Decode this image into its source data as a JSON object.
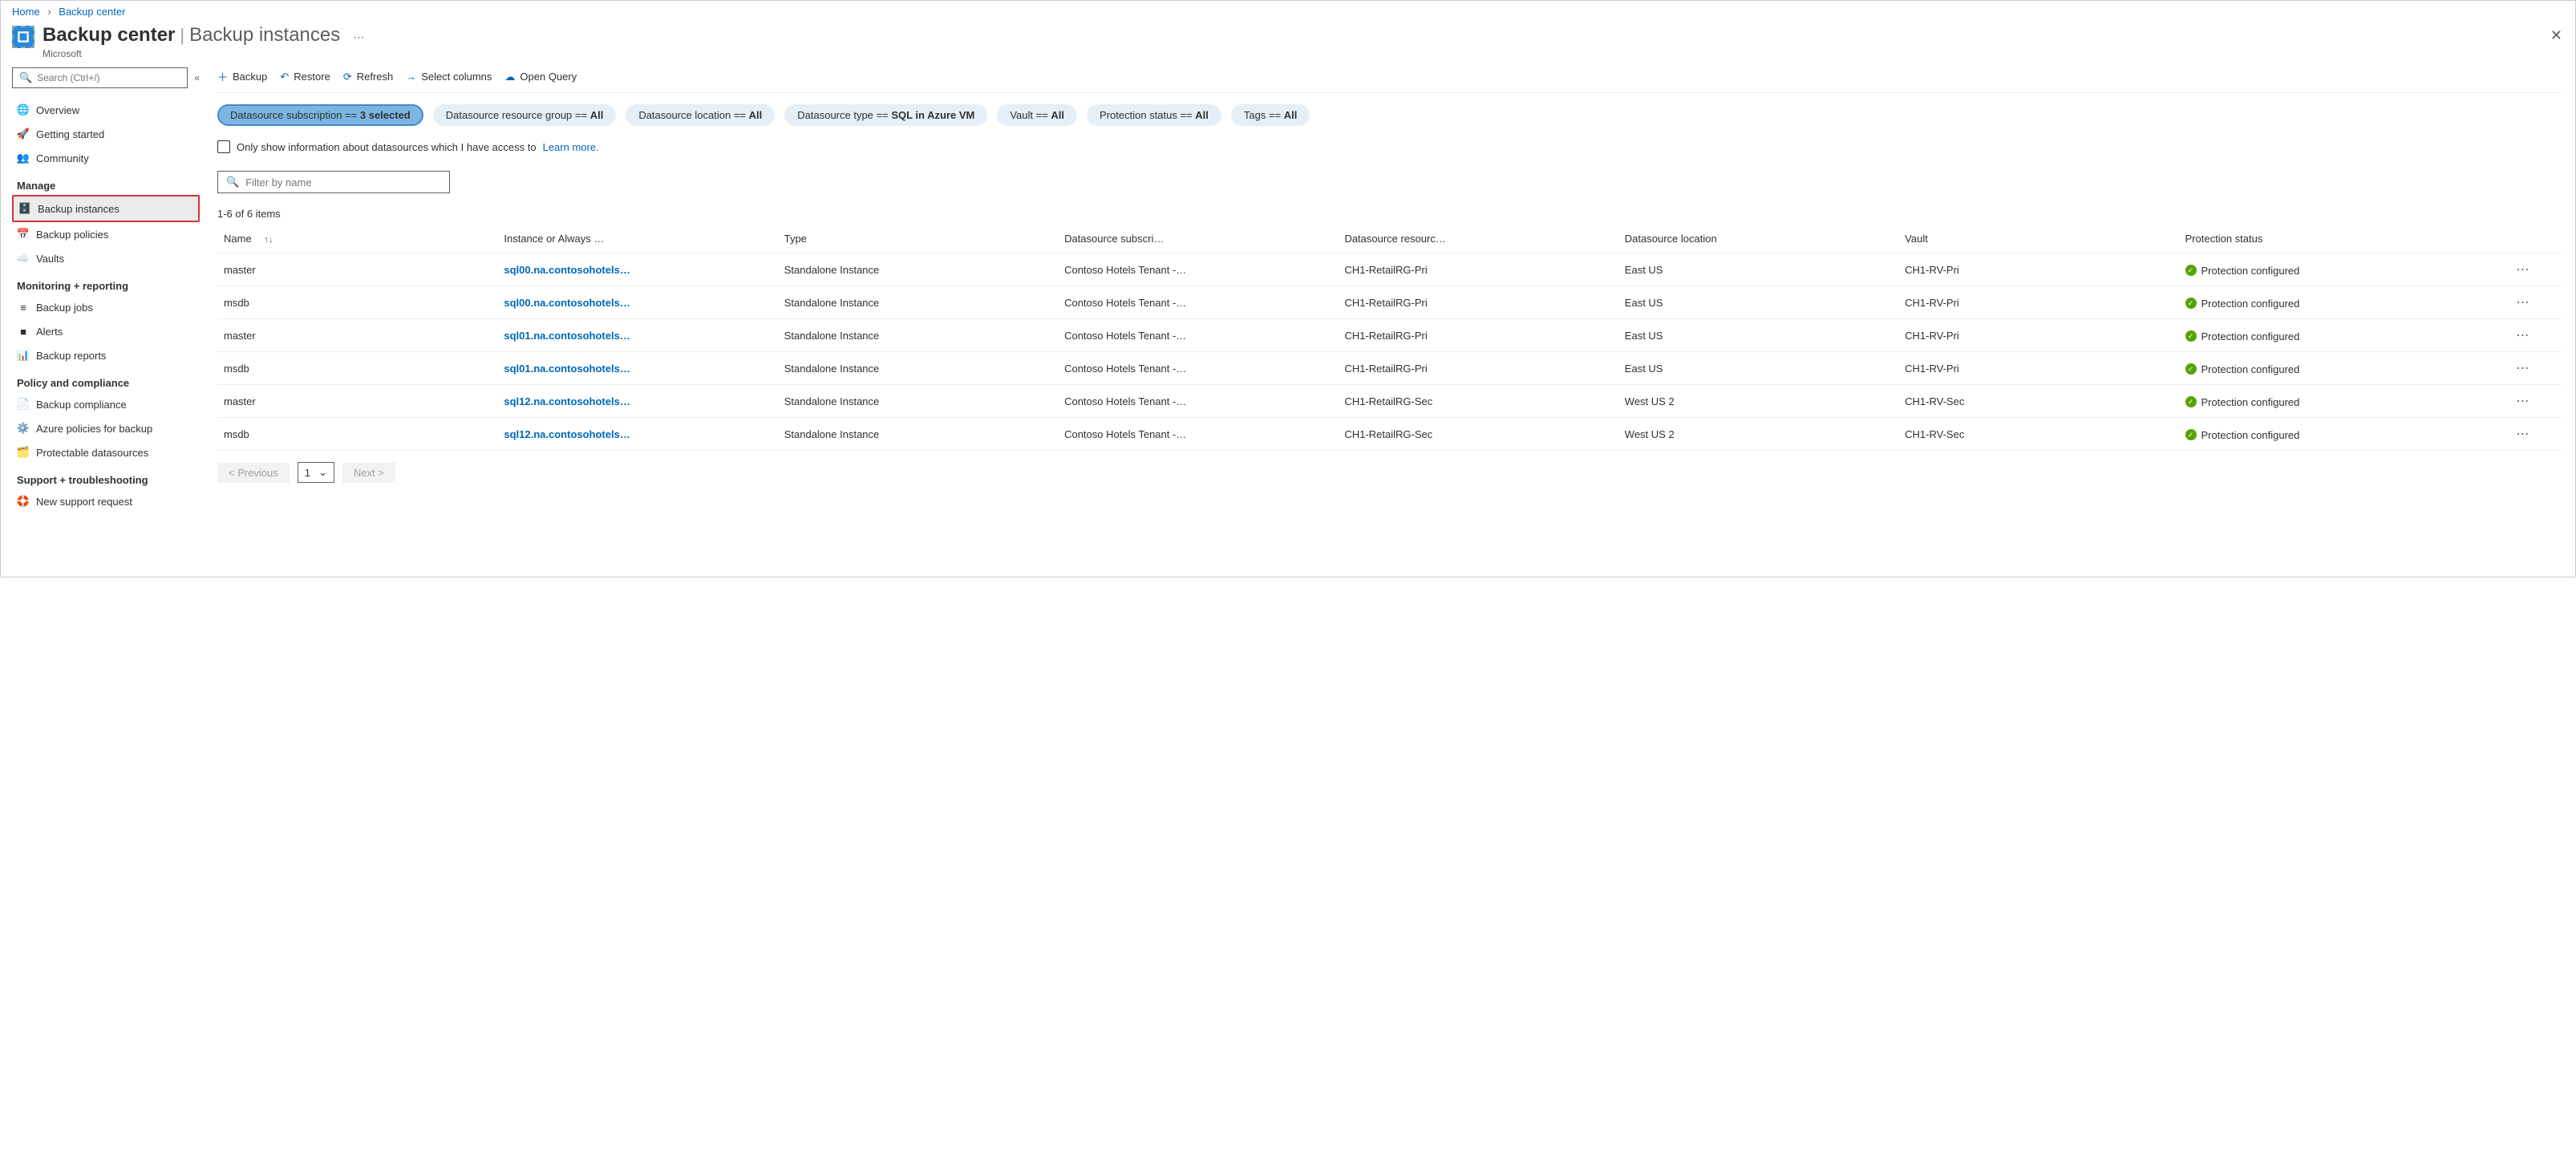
{
  "breadcrumb": {
    "home": "Home",
    "current": "Backup center"
  },
  "header": {
    "title": "Backup center",
    "subtitle": "Backup instances",
    "org": "Microsoft"
  },
  "sidebar": {
    "search_placeholder": "Search (Ctrl+/)",
    "items": [
      {
        "label": "Overview",
        "icon": "globe"
      },
      {
        "label": "Getting started",
        "icon": "rocket"
      },
      {
        "label": "Community",
        "icon": "people"
      }
    ],
    "manage_header": "Manage",
    "manage_items": [
      {
        "label": "Backup instances",
        "icon": "instance",
        "selected": true
      },
      {
        "label": "Backup policies",
        "icon": "policy"
      },
      {
        "label": "Vaults",
        "icon": "vault"
      }
    ],
    "monitor_header": "Monitoring + reporting",
    "monitor_items": [
      {
        "label": "Backup jobs",
        "icon": "jobs"
      },
      {
        "label": "Alerts",
        "icon": "alert"
      },
      {
        "label": "Backup reports",
        "icon": "report"
      }
    ],
    "policy_header": "Policy and compliance",
    "policy_items": [
      {
        "label": "Backup compliance",
        "icon": "compliance"
      },
      {
        "label": "Azure policies for backup",
        "icon": "azpolicy"
      },
      {
        "label": "Protectable datasources",
        "icon": "protectable"
      }
    ],
    "support_header": "Support + troubleshooting",
    "support_items": [
      {
        "label": "New support request",
        "icon": "support"
      }
    ]
  },
  "toolbar": {
    "backup": "Backup",
    "restore": "Restore",
    "refresh": "Refresh",
    "select_columns": "Select columns",
    "open_query": "Open Query"
  },
  "pills": [
    {
      "prefix": "Datasource subscription == ",
      "value": "3 selected",
      "active": true
    },
    {
      "prefix": "Datasource resource group == ",
      "value": "All"
    },
    {
      "prefix": "Datasource location == ",
      "value": "All"
    },
    {
      "prefix": "Datasource type == ",
      "value": "SQL in Azure VM"
    },
    {
      "prefix": "Vault == ",
      "value": "All"
    },
    {
      "prefix": "Protection status == ",
      "value": "All"
    },
    {
      "prefix": "Tags == ",
      "value": "All"
    }
  ],
  "onlyshow": {
    "text": "Only show information about datasources which I have access to ",
    "link": "Learn more."
  },
  "filter": {
    "placeholder": "Filter by name"
  },
  "count_text": "1-6 of 6 items",
  "columns": {
    "name": "Name",
    "instance": "Instance or Always …",
    "type": "Type",
    "subscription": "Datasource subscri…",
    "resource_group": "Datasource resourc…",
    "location": "Datasource location",
    "vault": "Vault",
    "status": "Protection status"
  },
  "rows": [
    {
      "name": "master",
      "instance": "sql00.na.contosohotels…",
      "type": "Standalone Instance",
      "subscription": "Contoso Hotels Tenant -…",
      "rg": "CH1-RetailRG-Pri",
      "location": "East US",
      "vault": "CH1-RV-Pri",
      "status": "Protection configured"
    },
    {
      "name": "msdb",
      "instance": "sql00.na.contosohotels…",
      "type": "Standalone Instance",
      "subscription": "Contoso Hotels Tenant -…",
      "rg": "CH1-RetailRG-Pri",
      "location": "East US",
      "vault": "CH1-RV-Pri",
      "status": "Protection configured"
    },
    {
      "name": "master",
      "instance": "sql01.na.contosohotels…",
      "type": "Standalone Instance",
      "subscription": "Contoso Hotels Tenant -…",
      "rg": "CH1-RetailRG-Pri",
      "location": "East US",
      "vault": "CH1-RV-Pri",
      "status": "Protection configured"
    },
    {
      "name": "msdb",
      "instance": "sql01.na.contosohotels…",
      "type": "Standalone Instance",
      "subscription": "Contoso Hotels Tenant -…",
      "rg": "CH1-RetailRG-Pri",
      "location": "East US",
      "vault": "CH1-RV-Pri",
      "status": "Protection configured"
    },
    {
      "name": "master",
      "instance": "sql12.na.contosohotels…",
      "type": "Standalone Instance",
      "subscription": "Contoso Hotels Tenant -…",
      "rg": "CH1-RetailRG-Sec",
      "location": "West US 2",
      "vault": "CH1-RV-Sec",
      "status": "Protection configured"
    },
    {
      "name": "msdb",
      "instance": "sql12.na.contosohotels…",
      "type": "Standalone Instance",
      "subscription": "Contoso Hotels Tenant -…",
      "rg": "CH1-RetailRG-Sec",
      "location": "West US 2",
      "vault": "CH1-RV-Sec",
      "status": "Protection configured"
    }
  ],
  "pager": {
    "prev": "< Previous",
    "page": "1",
    "next": "Next >"
  }
}
